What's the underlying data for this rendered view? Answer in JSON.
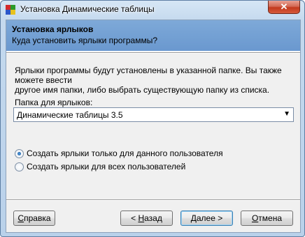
{
  "window": {
    "title": "Установка Динамические таблицы",
    "close_glyph": "✕"
  },
  "header": {
    "title": "Установка ярлыков",
    "subtitle": "Куда установить ярлыки программы?"
  },
  "description": {
    "line1": "Ярлыки программы будут установлены в указанной папке. Вы также можете ввести",
    "line2": "другое имя папки, либо выбрать существующую папку из списка."
  },
  "folder": {
    "label": "Папка для ярлыков:",
    "value": "Динамические таблицы 3.5",
    "arrow": "▼"
  },
  "options": [
    {
      "label": "Создать ярлыки только для данного пользователя",
      "selected": true
    },
    {
      "label": "Создать ярлыки для всех пользователей",
      "selected": false
    }
  ],
  "buttons": {
    "help": {
      "mnemonic": "С",
      "rest": "правка"
    },
    "back": {
      "prefix": "< ",
      "mnemonic": "Н",
      "rest": "азад"
    },
    "next": {
      "mnemonic": "Д",
      "rest": "алее >"
    },
    "cancel": {
      "mnemonic": "О",
      "rest": "тмена"
    }
  },
  "colors": {
    "header_band": "#6a98cf",
    "close_button": "#c2391d"
  }
}
